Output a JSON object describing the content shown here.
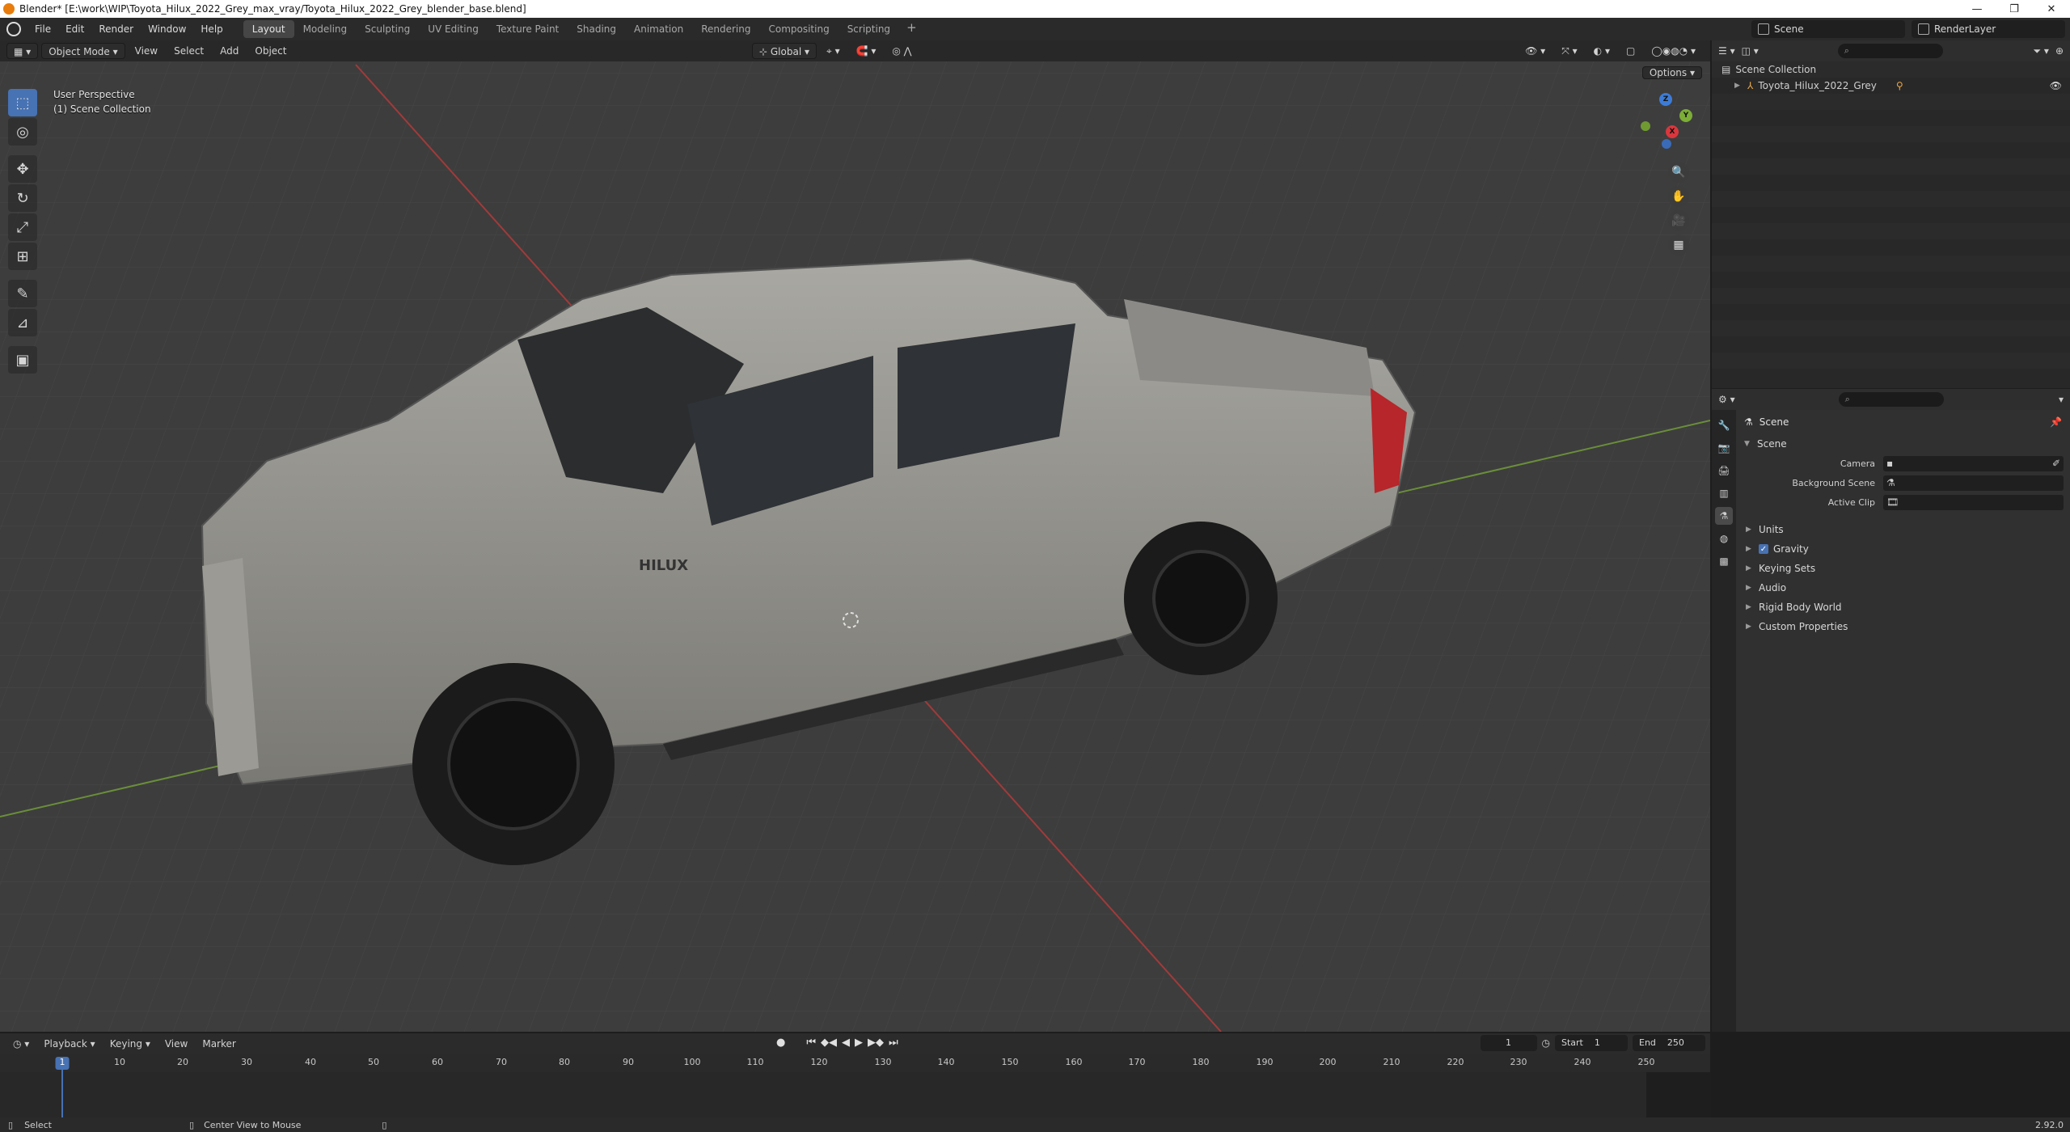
{
  "window": {
    "title": "Blender* [E:\\work\\WIP\\Toyota_Hilux_2022_Grey_max_vray/Toyota_Hilux_2022_Grey_blender_base.blend]",
    "controls": [
      "—",
      "❐",
      "✕"
    ]
  },
  "menu": [
    "File",
    "Edit",
    "Render",
    "Window",
    "Help"
  ],
  "workspaces": [
    "Layout",
    "Modeling",
    "Sculpting",
    "UV Editing",
    "Texture Paint",
    "Shading",
    "Animation",
    "Rendering",
    "Compositing",
    "Scripting"
  ],
  "active_workspace": "Layout",
  "scene_field": "Scene",
  "view_layer_field": "RenderLayer",
  "viewport": {
    "mode": "Object Mode",
    "menus": [
      "View",
      "Select",
      "Add",
      "Object"
    ],
    "orientation": "Global",
    "options": "Options",
    "overlay_line1": "User Perspective",
    "overlay_line2": "(1) Scene Collection",
    "car_badge": "HILUX",
    "gizmo_axes": [
      "X",
      "Y",
      "Z"
    ]
  },
  "tools": [
    {
      "name": "select-box-tool",
      "glyph": "⬚"
    },
    {
      "name": "cursor-tool",
      "glyph": "◎"
    },
    {
      "name": "move-tool",
      "glyph": "✥"
    },
    {
      "name": "rotate-tool",
      "glyph": "↻"
    },
    {
      "name": "scale-tool",
      "glyph": "⤢"
    },
    {
      "name": "transform-tool",
      "glyph": "⊞"
    },
    {
      "name": "annotate-tool",
      "glyph": "✎"
    },
    {
      "name": "measure-tool",
      "glyph": "📐"
    },
    {
      "name": "add-cube-tool",
      "glyph": "▣"
    }
  ],
  "outliner": {
    "root": "Scene Collection",
    "items": [
      "Toyota_Hilux_2022_Grey"
    ]
  },
  "properties": {
    "title": "Scene",
    "section": "Scene",
    "fields": [
      {
        "label": "Camera",
        "value": ""
      },
      {
        "label": "Background Scene",
        "value": ""
      },
      {
        "label": "Active Clip",
        "value": ""
      }
    ],
    "subsections": [
      "Units",
      "Gravity",
      "Keying Sets",
      "Audio",
      "Rigid Body World",
      "Custom Properties"
    ],
    "gravity_checked": true
  },
  "timeline": {
    "menus": [
      "Playback",
      "Keying",
      "View",
      "Marker"
    ],
    "current_frame": "1",
    "start_label": "Start",
    "start_value": "1",
    "end_label": "End",
    "end_value": "250",
    "ticks": [
      "10",
      "20",
      "30",
      "40",
      "50",
      "60",
      "70",
      "80",
      "90",
      "100",
      "110",
      "120",
      "130",
      "140",
      "150",
      "160",
      "170",
      "180",
      "190",
      "200",
      "210",
      "220",
      "230",
      "240",
      "250"
    ],
    "playhead_label": "1"
  },
  "statusbar": {
    "left": "Select",
    "middle": "Center View to Mouse",
    "version": "2.92.0"
  }
}
